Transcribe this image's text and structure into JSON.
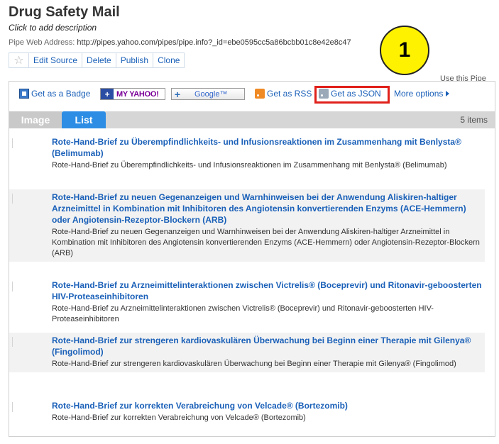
{
  "pipe": {
    "title": "Drug Safety Mail",
    "description": "Click to add description",
    "web_address_label": "Pipe Web Address:",
    "web_address_url": "http://pipes.yahoo.com/pipes/pipe.info?_id=ebe0595cc5a86bcbb01c8e42e8c47"
  },
  "actions": {
    "edit_source": "Edit Source",
    "delete": "Delete",
    "publish": "Publish",
    "clone": "Clone"
  },
  "annotation_marker": "1",
  "use_pipe_label": "Use this Pipe",
  "get_options": {
    "badge": "Get as a Badge",
    "myyahoo": "MY YAHOO!",
    "google": "Google™",
    "rss": "Get as RSS",
    "json": "Get as JSON",
    "more": "More options"
  },
  "tabs": {
    "image": "Image",
    "list": "List",
    "count": "5 items"
  },
  "items": [
    {
      "title": "Rote-Hand-Brief zu Überempfindlichkeits- und Infusionsreaktionen im Zusammenhang mit Benlysta® (Belimumab)",
      "description": "Rote-Hand-Brief zu Überempfindlichkeits- und Infusionsreaktionen im Zusammenhang mit Benlysta® (Belimumab)"
    },
    {
      "title": "Rote-Hand-Brief zu neuen Gegenanzeigen und Warnhinweisen bei der Anwendung Aliskiren-haltiger Arzneimittel in Kombination mit Inhibitoren des Angiotensin konvertierenden Enzyms (ACE-Hemmern) oder Angiotensin-Rezeptor-Blockern (ARB)",
      "description": "Rote-Hand-Brief zu neuen Gegenanzeigen und Warnhinweisen bei der Anwendung Aliskiren-haltiger Arzneimittel in Kombination mit Inhibitoren des Angiotensin konvertierenden Enzyms (ACE-Hemmern) oder Angiotensin-Rezeptor-Blockern (ARB)"
    },
    {
      "title": "Rote-Hand-Brief zu Arzneimittelinteraktionen zwischen Victrelis® (Boceprevir) und Ritonavir-geboosterten HIV-Proteaseinhibitoren",
      "description": "Rote-Hand-Brief zu Arzneimittelinteraktionen zwischen Victrelis® (Boceprevir) und Ritonavir-geboosterten HIV-Proteaseinhibitoren"
    },
    {
      "title": "Rote-Hand-Brief zur strengeren kardiovaskulären Überwachung bei Beginn einer Therapie mit Gilenya® (Fingolimod)",
      "description": "Rote-Hand-Brief zur strengeren kardiovaskulären Überwachung bei Beginn einer Therapie mit Gilenya® (Fingolimod)"
    },
    {
      "title": "Rote-Hand-Brief zur korrekten Verabreichung von Velcade® (Bortezomib)",
      "description": "Rote-Hand-Brief zur korrekten Verabreichung von Velcade® (Bortezomib)"
    }
  ]
}
